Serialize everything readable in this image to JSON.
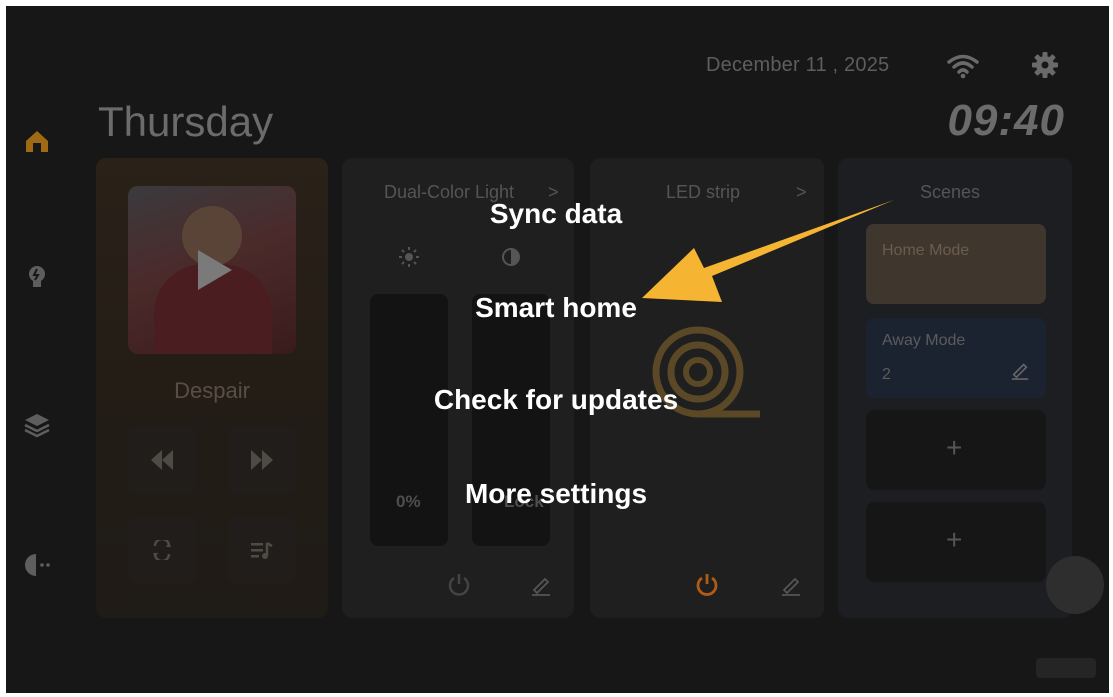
{
  "header": {
    "date": "December 11 , 2025",
    "day": "Thursday",
    "time": "09:40"
  },
  "sidebar": {
    "items": [
      {
        "icon": "home-icon"
      },
      {
        "icon": "bulb-icon"
      },
      {
        "icon": "layers-icon"
      },
      {
        "icon": "robot-icon"
      }
    ]
  },
  "music": {
    "song": "Despair"
  },
  "dual_light": {
    "title": "Dual-Color Light",
    "brightness": "0%",
    "temperature_label": "Lock"
  },
  "led_strip": {
    "title": "LED strip"
  },
  "scenes": {
    "title": "Scenes",
    "items": [
      {
        "label": "Home Mode"
      },
      {
        "label": "Away Mode",
        "count": "2"
      }
    ],
    "add_label": "+"
  },
  "overlay_menu": {
    "items": [
      {
        "label": "Sync data"
      },
      {
        "label": "Smart home"
      },
      {
        "label": "Check for updates"
      },
      {
        "label": "More settings"
      }
    ]
  },
  "colors": {
    "arrow": "#f5b533",
    "accent_orange": "#d9701d"
  }
}
